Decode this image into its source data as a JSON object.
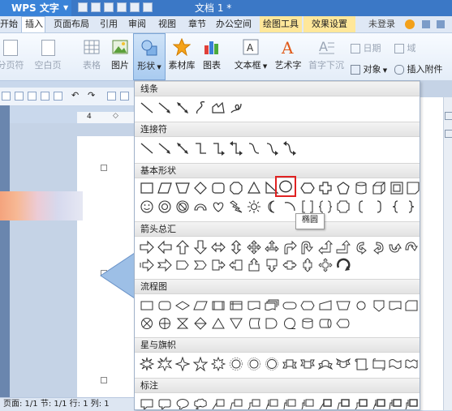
{
  "app": {
    "name": "WPS 文字",
    "doc_title": "文档 1 *"
  },
  "menu": {
    "tabs": [
      {
        "label": "开始"
      },
      {
        "label": "插入"
      },
      {
        "label": "页面布局"
      },
      {
        "label": "引用"
      },
      {
        "label": "审阅"
      },
      {
        "label": "视图"
      },
      {
        "label": "章节"
      },
      {
        "label": "办公空间"
      },
      {
        "label": "绘图工具"
      },
      {
        "label": "效果设置"
      }
    ],
    "login": "未登录"
  },
  "ribbon": {
    "fenye": "分页符",
    "kongbai": "空白页",
    "table": "表格",
    "picture": "图片",
    "shape": "形状",
    "material": "素材库",
    "chart": "图表",
    "textbox": "文本框",
    "wordart": "艺术字",
    "dropcap": "首字下沉",
    "date": "日期",
    "field": "域",
    "object": "对象",
    "attachment": "插入附件"
  },
  "ruler": {
    "mark": "4"
  },
  "status": {
    "text": "页面: 1/1  节: 1/1  行: 1  列: 1"
  },
  "sections": [
    {
      "title": "线条"
    },
    {
      "title": "连接符"
    },
    {
      "title": "基本形状"
    },
    {
      "title": "箭头总汇"
    },
    {
      "title": "流程图"
    },
    {
      "title": "星与旗帜"
    },
    {
      "title": "标注"
    }
  ],
  "tooltip": "椭圆",
  "colors": {
    "titlebar": "#3b78c6",
    "highlight": "#e02222",
    "shape_stroke": "#333333"
  }
}
